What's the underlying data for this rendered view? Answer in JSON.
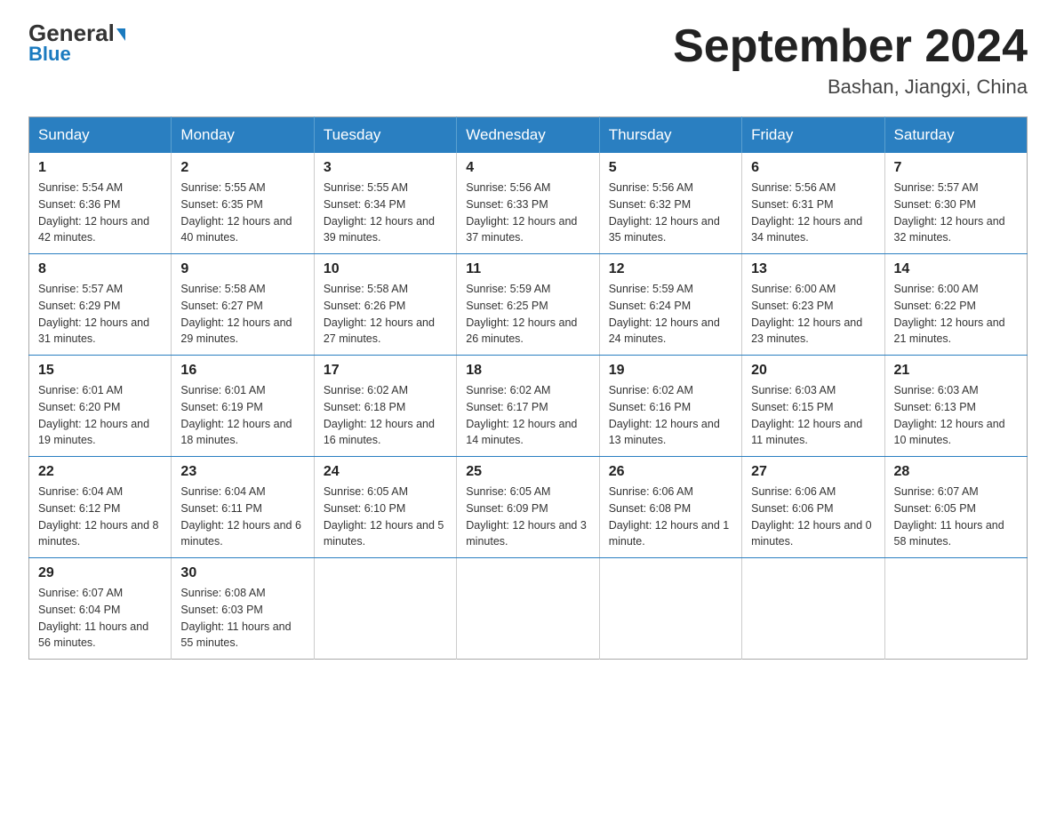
{
  "header": {
    "logo_general": "General",
    "logo_blue": "Blue",
    "month_year": "September 2024",
    "location": "Bashan, Jiangxi, China"
  },
  "days_of_week": [
    "Sunday",
    "Monday",
    "Tuesday",
    "Wednesday",
    "Thursday",
    "Friday",
    "Saturday"
  ],
  "weeks": [
    [
      {
        "day": "1",
        "sunrise": "Sunrise: 5:54 AM",
        "sunset": "Sunset: 6:36 PM",
        "daylight": "Daylight: 12 hours and 42 minutes."
      },
      {
        "day": "2",
        "sunrise": "Sunrise: 5:55 AM",
        "sunset": "Sunset: 6:35 PM",
        "daylight": "Daylight: 12 hours and 40 minutes."
      },
      {
        "day": "3",
        "sunrise": "Sunrise: 5:55 AM",
        "sunset": "Sunset: 6:34 PM",
        "daylight": "Daylight: 12 hours and 39 minutes."
      },
      {
        "day": "4",
        "sunrise": "Sunrise: 5:56 AM",
        "sunset": "Sunset: 6:33 PM",
        "daylight": "Daylight: 12 hours and 37 minutes."
      },
      {
        "day": "5",
        "sunrise": "Sunrise: 5:56 AM",
        "sunset": "Sunset: 6:32 PM",
        "daylight": "Daylight: 12 hours and 35 minutes."
      },
      {
        "day": "6",
        "sunrise": "Sunrise: 5:56 AM",
        "sunset": "Sunset: 6:31 PM",
        "daylight": "Daylight: 12 hours and 34 minutes."
      },
      {
        "day": "7",
        "sunrise": "Sunrise: 5:57 AM",
        "sunset": "Sunset: 6:30 PM",
        "daylight": "Daylight: 12 hours and 32 minutes."
      }
    ],
    [
      {
        "day": "8",
        "sunrise": "Sunrise: 5:57 AM",
        "sunset": "Sunset: 6:29 PM",
        "daylight": "Daylight: 12 hours and 31 minutes."
      },
      {
        "day": "9",
        "sunrise": "Sunrise: 5:58 AM",
        "sunset": "Sunset: 6:27 PM",
        "daylight": "Daylight: 12 hours and 29 minutes."
      },
      {
        "day": "10",
        "sunrise": "Sunrise: 5:58 AM",
        "sunset": "Sunset: 6:26 PM",
        "daylight": "Daylight: 12 hours and 27 minutes."
      },
      {
        "day": "11",
        "sunrise": "Sunrise: 5:59 AM",
        "sunset": "Sunset: 6:25 PM",
        "daylight": "Daylight: 12 hours and 26 minutes."
      },
      {
        "day": "12",
        "sunrise": "Sunrise: 5:59 AM",
        "sunset": "Sunset: 6:24 PM",
        "daylight": "Daylight: 12 hours and 24 minutes."
      },
      {
        "day": "13",
        "sunrise": "Sunrise: 6:00 AM",
        "sunset": "Sunset: 6:23 PM",
        "daylight": "Daylight: 12 hours and 23 minutes."
      },
      {
        "day": "14",
        "sunrise": "Sunrise: 6:00 AM",
        "sunset": "Sunset: 6:22 PM",
        "daylight": "Daylight: 12 hours and 21 minutes."
      }
    ],
    [
      {
        "day": "15",
        "sunrise": "Sunrise: 6:01 AM",
        "sunset": "Sunset: 6:20 PM",
        "daylight": "Daylight: 12 hours and 19 minutes."
      },
      {
        "day": "16",
        "sunrise": "Sunrise: 6:01 AM",
        "sunset": "Sunset: 6:19 PM",
        "daylight": "Daylight: 12 hours and 18 minutes."
      },
      {
        "day": "17",
        "sunrise": "Sunrise: 6:02 AM",
        "sunset": "Sunset: 6:18 PM",
        "daylight": "Daylight: 12 hours and 16 minutes."
      },
      {
        "day": "18",
        "sunrise": "Sunrise: 6:02 AM",
        "sunset": "Sunset: 6:17 PM",
        "daylight": "Daylight: 12 hours and 14 minutes."
      },
      {
        "day": "19",
        "sunrise": "Sunrise: 6:02 AM",
        "sunset": "Sunset: 6:16 PM",
        "daylight": "Daylight: 12 hours and 13 minutes."
      },
      {
        "day": "20",
        "sunrise": "Sunrise: 6:03 AM",
        "sunset": "Sunset: 6:15 PM",
        "daylight": "Daylight: 12 hours and 11 minutes."
      },
      {
        "day": "21",
        "sunrise": "Sunrise: 6:03 AM",
        "sunset": "Sunset: 6:13 PM",
        "daylight": "Daylight: 12 hours and 10 minutes."
      }
    ],
    [
      {
        "day": "22",
        "sunrise": "Sunrise: 6:04 AM",
        "sunset": "Sunset: 6:12 PM",
        "daylight": "Daylight: 12 hours and 8 minutes."
      },
      {
        "day": "23",
        "sunrise": "Sunrise: 6:04 AM",
        "sunset": "Sunset: 6:11 PM",
        "daylight": "Daylight: 12 hours and 6 minutes."
      },
      {
        "day": "24",
        "sunrise": "Sunrise: 6:05 AM",
        "sunset": "Sunset: 6:10 PM",
        "daylight": "Daylight: 12 hours and 5 minutes."
      },
      {
        "day": "25",
        "sunrise": "Sunrise: 6:05 AM",
        "sunset": "Sunset: 6:09 PM",
        "daylight": "Daylight: 12 hours and 3 minutes."
      },
      {
        "day": "26",
        "sunrise": "Sunrise: 6:06 AM",
        "sunset": "Sunset: 6:08 PM",
        "daylight": "Daylight: 12 hours and 1 minute."
      },
      {
        "day": "27",
        "sunrise": "Sunrise: 6:06 AM",
        "sunset": "Sunset: 6:06 PM",
        "daylight": "Daylight: 12 hours and 0 minutes."
      },
      {
        "day": "28",
        "sunrise": "Sunrise: 6:07 AM",
        "sunset": "Sunset: 6:05 PM",
        "daylight": "Daylight: 11 hours and 58 minutes."
      }
    ],
    [
      {
        "day": "29",
        "sunrise": "Sunrise: 6:07 AM",
        "sunset": "Sunset: 6:04 PM",
        "daylight": "Daylight: 11 hours and 56 minutes."
      },
      {
        "day": "30",
        "sunrise": "Sunrise: 6:08 AM",
        "sunset": "Sunset: 6:03 PM",
        "daylight": "Daylight: 11 hours and 55 minutes."
      },
      null,
      null,
      null,
      null,
      null
    ]
  ]
}
